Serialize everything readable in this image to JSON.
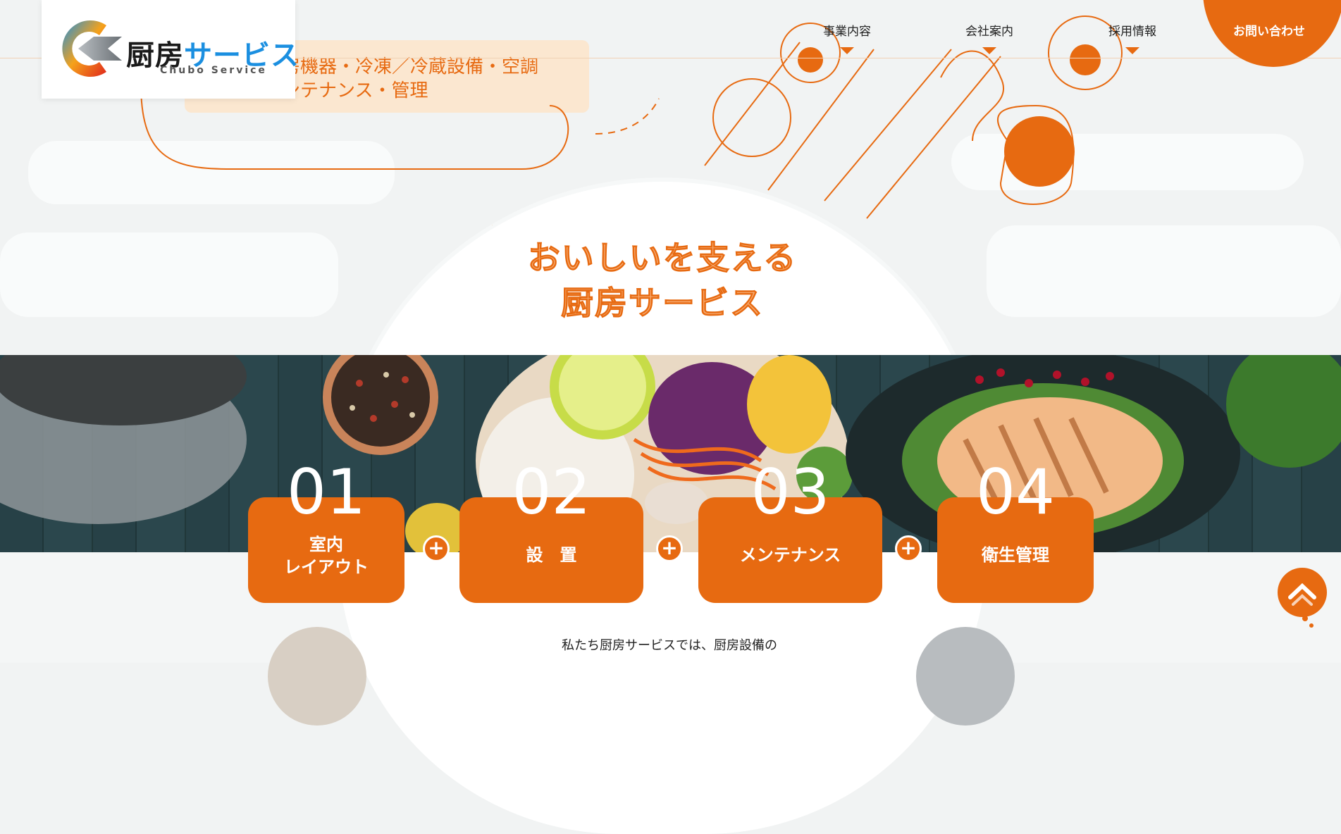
{
  "brand": {
    "logo_text_black": "厨房",
    "logo_text_blue": "サービス",
    "logo_sub": "Chubo Service"
  },
  "nav": {
    "items": [
      {
        "label": "事業内容"
      },
      {
        "label": "会社案内"
      },
      {
        "label": "採用情報"
      }
    ],
    "contact_label": "お問い合わせ"
  },
  "tagline": {
    "line1": "房機器・冷凍／冷蔵設備・空調",
    "line2": "ンテナンス・管理"
  },
  "hero": {
    "title_line1": "おいしいを支える",
    "title_line2": "厨房サービス"
  },
  "steps": [
    {
      "num": "01",
      "label_line1": "室内",
      "label_line2": "レイアウト"
    },
    {
      "num": "02",
      "label_line1": "設　置",
      "label_line2": ""
    },
    {
      "num": "03",
      "label_line1": "メンテナンス",
      "label_line2": ""
    },
    {
      "num": "04",
      "label_line1": "衛生管理",
      "label_line2": ""
    }
  ],
  "intro": {
    "line1": "私たち厨房サービスでは、厨房設備の"
  },
  "colors": {
    "accent": "#e76a11",
    "title_fill": "#f7ab72",
    "tag_bg": "#fbe6cd",
    "logo_blue": "#1b8fe0",
    "background": "#f1f3f3"
  },
  "icons": {
    "back_to_top": "chevron-up-icon",
    "step_connector": "plus-icon"
  }
}
